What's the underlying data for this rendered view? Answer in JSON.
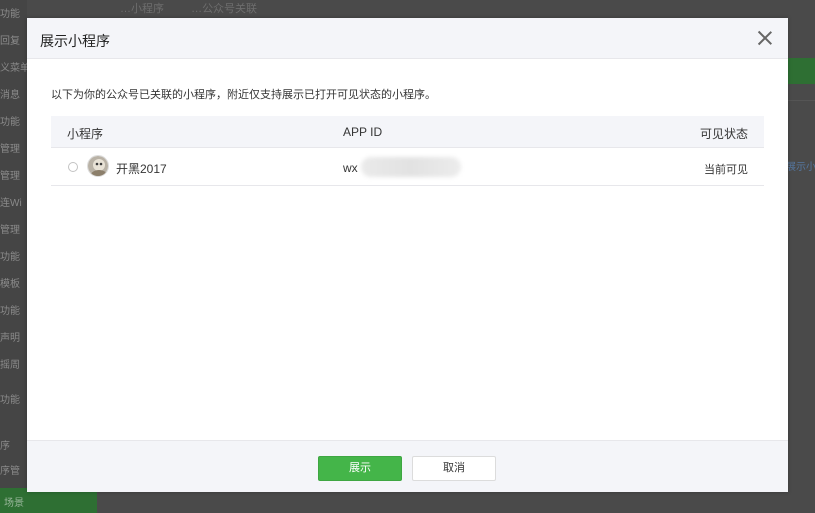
{
  "background": {
    "sidebar_items": [
      "功能",
      "回复",
      "义菜单",
      "消息",
      "功能",
      "管理",
      "管理",
      "连Wi",
      "管理",
      "功能",
      "模板",
      "功能",
      "声明",
      "摇周",
      "功能",
      "序",
      "序管",
      "场景"
    ],
    "tabs": [
      "…小程序",
      "…公众号关联"
    ],
    "right_link": "展示小"
  },
  "modal": {
    "title": "展示小程序",
    "intro": "以下为你的公众号已关联的小程序，附近仅支持展示已打开可见状态的小程序。",
    "table": {
      "headers": {
        "name": "小程序",
        "appid": "APP ID",
        "status": "可见状态"
      },
      "rows": [
        {
          "name": "开黑2017",
          "appid_prefix": "wx",
          "status": "当前可见"
        }
      ]
    },
    "footer": {
      "confirm_label": "展示",
      "cancel_label": "取消"
    }
  },
  "colors": {
    "primary": "#44b549",
    "header_bg": "#f4f5f9",
    "overlay": "#4a4a4a"
  }
}
